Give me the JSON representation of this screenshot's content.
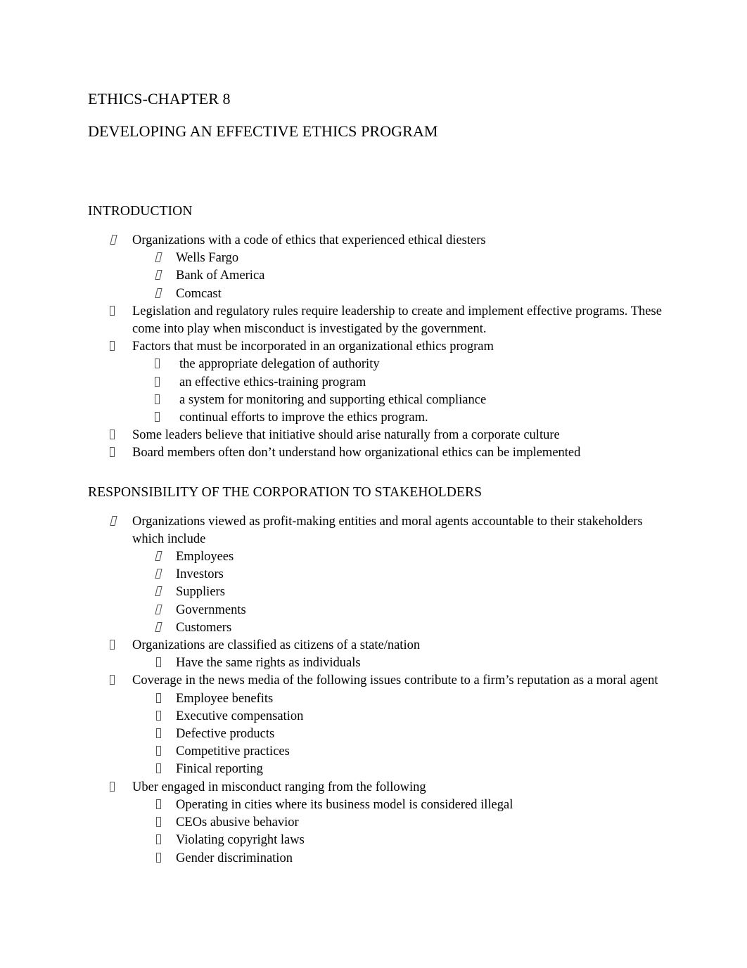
{
  "document": {
    "title_line_1": "ETHICS-CHAPTER 8",
    "title_line_2": "DEVELOPING AN EFFECTIVE ETHICS PROGRAM"
  },
  "sections": [
    {
      "heading": "INTRODUCTION",
      "items": [
        {
          "level": 1,
          "bullet": "tofu-slanted",
          "text": "Organizations with a code of ethics that experienced ethical diesters"
        },
        {
          "level": 2,
          "bullet": "tofu-slanted",
          "text": "Wells Fargo"
        },
        {
          "level": 2,
          "bullet": "tofu-slanted",
          "text": "Bank of America"
        },
        {
          "level": 2,
          "bullet": "tofu-slanted",
          "text": "Comcast"
        },
        {
          "level": 1,
          "bullet": "tofu-upright",
          "text": "Legislation and regulatory rules require leadership to create and implement effective programs. These come into play when misconduct is investigated by the government."
        },
        {
          "level": 1,
          "bullet": "tofu-upright",
          "text": "Factors that must be incorporated in an organizational ethics program"
        },
        {
          "level": 2,
          "bullet": "tofu-upright",
          "deep": true,
          "text": " the appropriate delegation of authority"
        },
        {
          "level": 2,
          "bullet": "tofu-upright",
          "deep": true,
          "text": " an effective ethics-training program"
        },
        {
          "level": 2,
          "bullet": "tofu-upright",
          "deep": true,
          "text": " a system for monitoring and supporting ethical compliance"
        },
        {
          "level": 2,
          "bullet": "tofu-upright",
          "deep": true,
          "text": "continual efforts to improve the ethics program."
        },
        {
          "level": 1,
          "bullet": "tofu-upright",
          "text": "Some leaders believe that initiative should arise naturally from a corporate culture"
        },
        {
          "level": 1,
          "bullet": "tofu-upright",
          "text": "Board members often don’t understand how organizational ethics can be implemented"
        }
      ]
    },
    {
      "heading": "RESPONSIBILITY OF THE CORPORATION TO STAKEHOLDERS",
      "items": [
        {
          "level": 1,
          "bullet": "tofu-slanted",
          "text": "Organizations viewed as profit-making entities and moral agents accountable to their stakeholders which include"
        },
        {
          "level": 2,
          "bullet": "tofu-slanted",
          "text": "Employees"
        },
        {
          "level": 2,
          "bullet": "tofu-slanted",
          "text": "Investors"
        },
        {
          "level": 2,
          "bullet": "tofu-slanted",
          "text": "Suppliers"
        },
        {
          "level": 2,
          "bullet": "tofu-slanted",
          "text": "Governments"
        },
        {
          "level": 2,
          "bullet": "tofu-slanted",
          "text": "Customers"
        },
        {
          "level": 1,
          "bullet": "tofu-upright",
          "text": "Organizations are classified as citizens of a state/nation"
        },
        {
          "level": 2,
          "bullet": "tofu-upright",
          "text": "Have the same rights as individuals"
        },
        {
          "level": 1,
          "bullet": "tofu-upright",
          "text": "Coverage in the news media of the following issues contribute to a firm’s reputation as a moral agent"
        },
        {
          "level": 2,
          "bullet": "tofu-upright",
          "text": "Employee benefits"
        },
        {
          "level": 2,
          "bullet": "tofu-upright",
          "text": "Executive compensation"
        },
        {
          "level": 2,
          "bullet": "tofu-upright",
          "text": "Defective products"
        },
        {
          "level": 2,
          "bullet": "tofu-upright",
          "text": "Competitive practices"
        },
        {
          "level": 2,
          "bullet": "tofu-upright",
          "text": "Finical reporting"
        },
        {
          "level": 1,
          "bullet": "tofu-upright",
          "text": "Uber engaged in misconduct ranging from the following"
        },
        {
          "level": 2,
          "bullet": "tofu-upright",
          "text": "Operating in cities where its business model is considered illegal"
        },
        {
          "level": 2,
          "bullet": "tofu-upright",
          "text": "CEOs abusive behavior"
        },
        {
          "level": 2,
          "bullet": "tofu-upright",
          "text": "Violating copyright laws"
        },
        {
          "level": 2,
          "bullet": "tofu-upright",
          "text": "Gender discrimination"
        }
      ]
    }
  ],
  "colors": {
    "page_background": "#ffffff",
    "text": "#000000",
    "bullet_stroke": "#4a4a4a"
  }
}
